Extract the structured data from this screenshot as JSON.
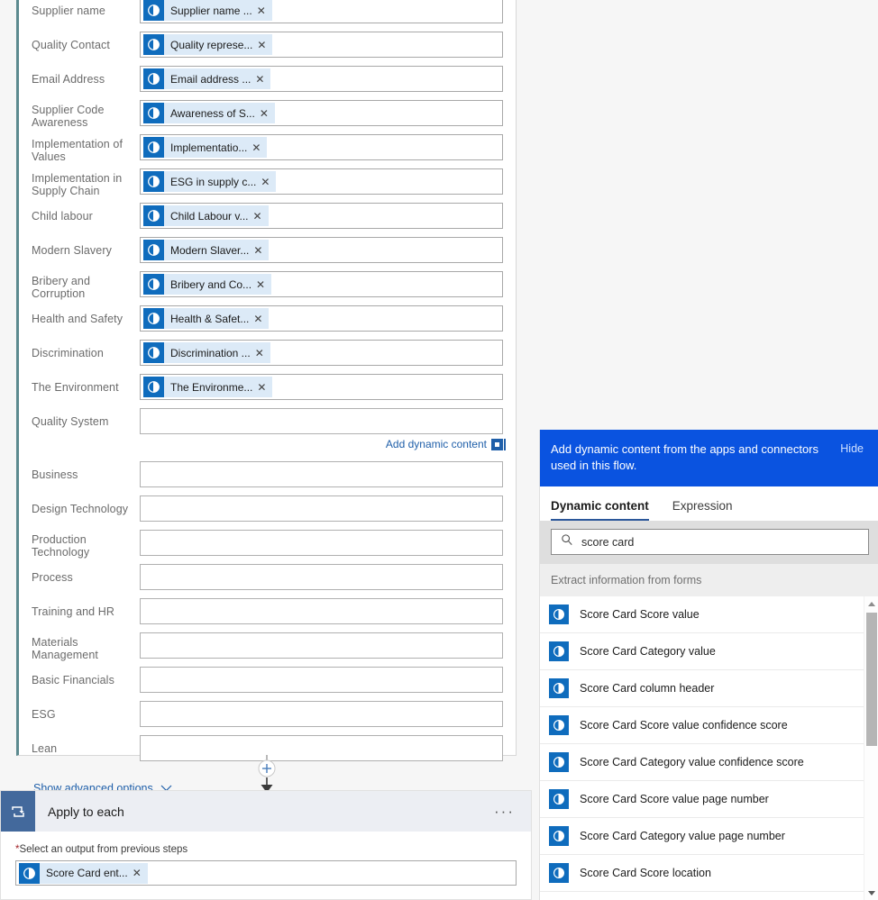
{
  "flow_card": {
    "fields": [
      {
        "label": "Supplier name",
        "token": "Supplier name ...",
        "has_token": true
      },
      {
        "label": "Quality Contact",
        "token": "Quality represe...",
        "has_token": true
      },
      {
        "label": "Email Address",
        "token": "Email address ...",
        "has_token": true
      },
      {
        "label": "Supplier Code Awareness",
        "token": "Awareness of S...",
        "has_token": true
      },
      {
        "label": "Implementation of Values",
        "token": "Implementatio...",
        "has_token": true
      },
      {
        "label": "Implementation in Supply Chain",
        "token": "ESG in supply c...",
        "has_token": true
      },
      {
        "label": "Child labour",
        "token": "Child Labour v...",
        "has_token": true
      },
      {
        "label": "Modern Slavery",
        "token": "Modern Slaver...",
        "has_token": true
      },
      {
        "label": "Bribery and Corruption",
        "token": "Bribery and Co...",
        "has_token": true
      },
      {
        "label": "Health and Safety",
        "token": "Health & Safet...",
        "has_token": true
      },
      {
        "label": "Discrimination",
        "token": "Discrimination ...",
        "has_token": true
      },
      {
        "label": "The Environment",
        "token": "The Environme...",
        "has_token": true
      },
      {
        "label": "Quality System",
        "token": "",
        "has_token": false
      }
    ],
    "add_dynamic_content_label": "Add dynamic content",
    "fields_after": [
      {
        "label": "Business",
        "token": "",
        "has_token": false
      },
      {
        "label": "Design Technology",
        "token": "",
        "has_token": false
      },
      {
        "label": "Production Technology",
        "token": "",
        "has_token": false
      },
      {
        "label": "Process",
        "token": "",
        "has_token": false
      },
      {
        "label": "Training and HR",
        "token": "",
        "has_token": false
      },
      {
        "label": "Materials Management",
        "token": "",
        "has_token": false
      },
      {
        "label": "Basic Financials",
        "token": "",
        "has_token": false
      },
      {
        "label": "ESG",
        "token": "",
        "has_token": false
      },
      {
        "label": "Lean",
        "token": "",
        "has_token": false
      }
    ],
    "show_advanced_options_label": "Show advanced options"
  },
  "apply_to_each": {
    "title": "Apply to each",
    "required_label_star": "*",
    "required_label": "Select an output from previous steps",
    "token": "Score Card ent...",
    "more_menu": "···"
  },
  "dynamic_content_panel": {
    "banner_text": "Add dynamic content from the apps and connectors used in this flow.",
    "hide_label": "Hide",
    "tabs": [
      {
        "label": "Dynamic content",
        "active": true
      },
      {
        "label": "Expression",
        "active": false
      }
    ],
    "search_value": "score card",
    "group_header": "Extract information from forms",
    "items": [
      {
        "label": "Score Card Score value"
      },
      {
        "label": "Score Card Category value"
      },
      {
        "label": "Score Card column header"
      },
      {
        "label": "Score Card Score value confidence score"
      },
      {
        "label": "Score Card Category value confidence score"
      },
      {
        "label": "Score Card Score value page number"
      },
      {
        "label": "Score Card Category value page number"
      },
      {
        "label": "Score Card Score location"
      }
    ]
  },
  "colors": {
    "banner_blue": "#0a53e0",
    "token_icon_blue": "#0f6cbd",
    "token_chip_bg": "#dceaf7",
    "link_blue": "#1f5fa9",
    "card_accent": "#5c8a8f",
    "loop_icon_blue": "#43699c",
    "tab_underline": "#2b579a"
  }
}
